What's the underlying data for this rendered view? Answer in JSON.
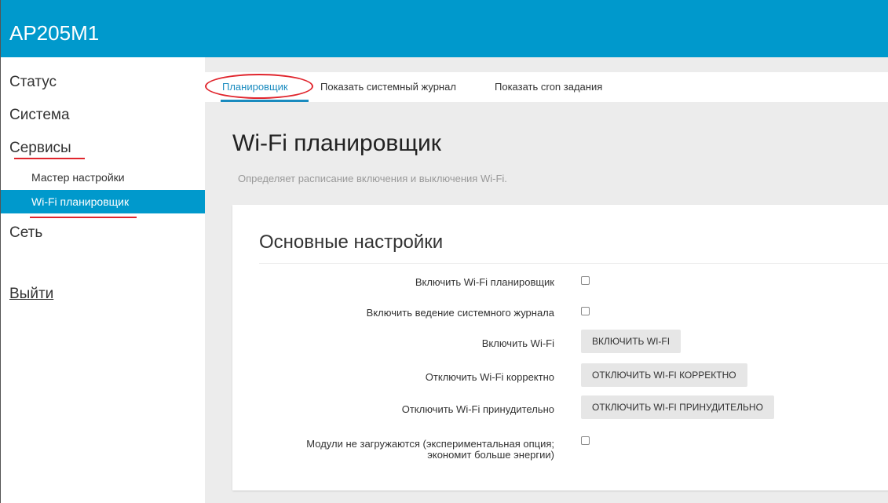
{
  "header": {
    "title": "AP205M1"
  },
  "sidebar": {
    "items": [
      {
        "label": "Статус"
      },
      {
        "label": "Система"
      },
      {
        "label": "Сервисы"
      },
      {
        "label": "Сеть"
      }
    ],
    "subitems": [
      {
        "label": "Мастер настройки"
      },
      {
        "label": "Wi-Fi планировщик",
        "active": true
      }
    ],
    "logout_label": "Выйти"
  },
  "tabs": [
    {
      "label": "Планировщик",
      "active": true
    },
    {
      "label": "Показать системный журнал"
    },
    {
      "label": "Показать cron задания"
    }
  ],
  "page": {
    "title": "Wi-Fi планировщик",
    "description": "Определяет расписание включения и выключения Wi-Fi."
  },
  "section": {
    "title": "Основные настройки",
    "rows": [
      {
        "label": "Включить Wi-Fi планировщик",
        "control": "checkbox",
        "checked": false
      },
      {
        "label": "Включить ведение системного журнала",
        "control": "checkbox",
        "checked": false
      },
      {
        "label": "Включить Wi-Fi",
        "control": "button",
        "button_label": "ВКЛЮЧИТЬ WI-FI"
      },
      {
        "label": "Отключить Wi-Fi корректно",
        "control": "button",
        "button_label": "ОТКЛЮЧИТЬ WI-FI КОРРЕКТНО"
      },
      {
        "label": "Отключить Wi-Fi принудительно",
        "control": "button",
        "button_label": "ОТКЛЮЧИТЬ WI-FI ПРИНУДИТЕЛЬНО"
      },
      {
        "label": "Модули не загружаются (экспериментальная опция; экономит больше энергии)",
        "control": "checkbox",
        "checked": false
      }
    ]
  },
  "colors": {
    "accent": "#0099cc",
    "highlight_red": "#e0252d",
    "content_bg": "#ececec"
  }
}
